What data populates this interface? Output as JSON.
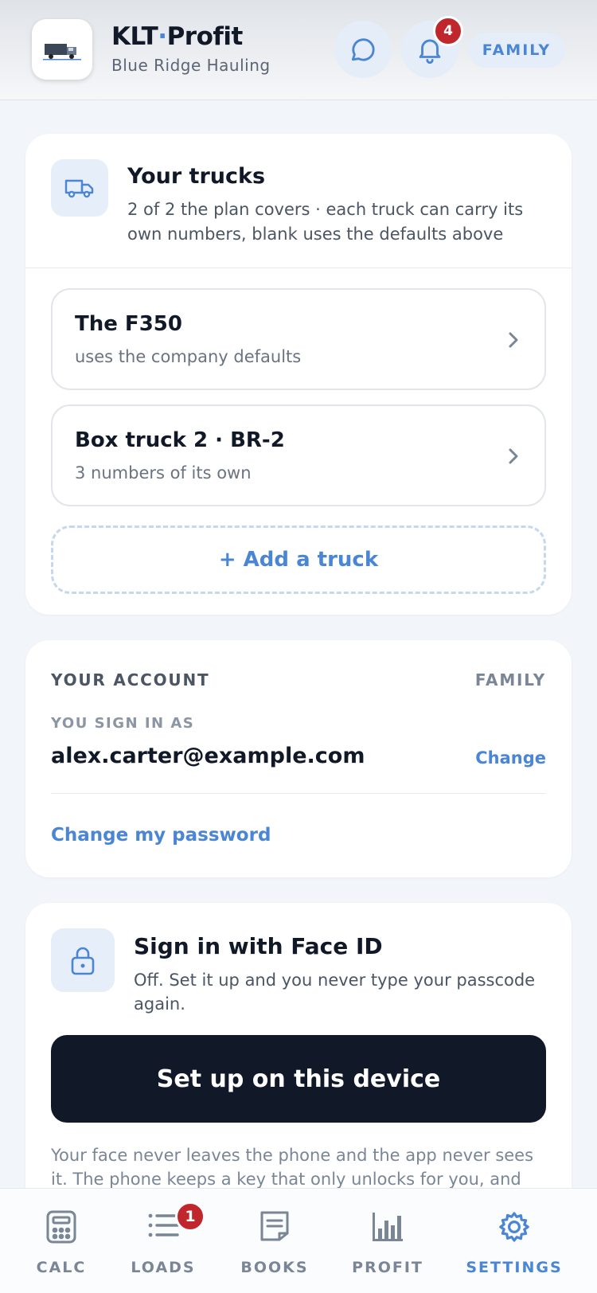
{
  "header": {
    "title_main": "KLT",
    "title_dot": "·",
    "title_rest": "Profit",
    "subtitle": "Blue Ridge Hauling",
    "notifications_count": "4",
    "plan": "FAMILY"
  },
  "trucks": {
    "title": "Your trucks",
    "description": "2 of 2 the plan covers · each truck can carry its own numbers, blank uses the defaults above",
    "items": [
      {
        "name": "The F350",
        "sub": "uses the company defaults"
      },
      {
        "name": "Box truck 2 · BR-2",
        "sub": "3 numbers of its own"
      }
    ],
    "add_label": "+ Add a truck"
  },
  "account": {
    "title": "YOUR ACCOUNT",
    "plan": "FAMILY",
    "signin_label": "YOU SIGN IN AS",
    "email": "alex.carter@example.com",
    "change_label": "Change",
    "password_label": "Change my password"
  },
  "faceid": {
    "title": "Sign in with Face ID",
    "description": "Off. Set it up and you never type your passcode again.",
    "button": "Set up on this device",
    "footnote": "Your face never leaves the phone and the app never sees it. The phone keeps a key that only unlocks for you, and"
  },
  "tabs": [
    {
      "label": "CALC",
      "icon": "calculator-icon"
    },
    {
      "label": "LOADS",
      "icon": "list-icon",
      "badge": "1"
    },
    {
      "label": "BOOKS",
      "icon": "document-icon"
    },
    {
      "label": "PROFIT",
      "icon": "bar-chart-icon"
    },
    {
      "label": "SETTINGS",
      "icon": "gear-icon",
      "active": true
    }
  ],
  "colors": {
    "accent": "#4a86d4",
    "dark": "#111827",
    "badge": "#c0272d"
  }
}
